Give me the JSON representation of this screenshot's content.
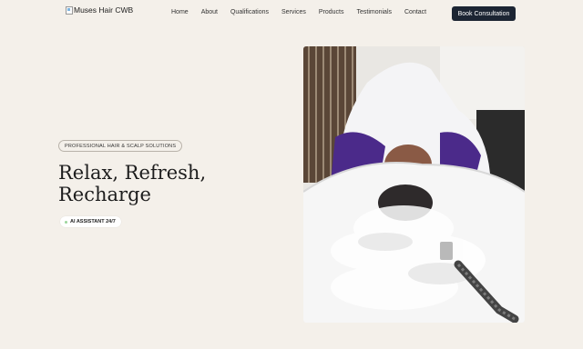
{
  "header": {
    "logo_alt": "Muses Hair CWB",
    "nav": [
      "Home",
      "About",
      "Qualifications",
      "Services",
      "Products",
      "Testimonials",
      "Contact"
    ],
    "cta_label": "Book Consultation"
  },
  "hero": {
    "tagline": "PROFESSIONAL HAIR & SCALP SOLUTIONS",
    "title_line1": "Relax, Refresh,",
    "title_line2": "Recharge",
    "ai_badge": "AI ASSISTANT 24/7",
    "image_subject": "client-at-shampoo-bowl-with-steam"
  },
  "colors": {
    "background": "#f4f0ea",
    "cta_bg": "#1c2533",
    "cta_text": "#ffffff",
    "gown_purple": "#4b2a8a",
    "status_dot": "#9bd59b"
  }
}
